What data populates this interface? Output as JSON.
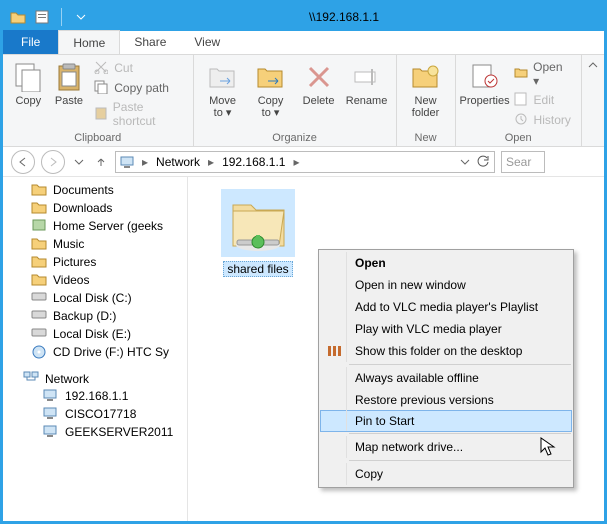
{
  "window": {
    "title": "\\\\192.168.1.1"
  },
  "tabs": {
    "file": "File",
    "home": "Home",
    "share": "Share",
    "view": "View"
  },
  "ribbon": {
    "clipboard": {
      "copy": "Copy",
      "paste": "Paste",
      "cut": "Cut",
      "copypath": "Copy path",
      "pasteshortcut": "Paste shortcut",
      "label": "Clipboard"
    },
    "organize": {
      "moveto": "Move\nto ▾",
      "copyto": "Copy\nto ▾",
      "delete": "Delete",
      "rename": "Rename",
      "label": "Organize"
    },
    "new": {
      "newfolder": "New\nfolder",
      "label": "New"
    },
    "open": {
      "properties": "Properties",
      "open": "Open ▾",
      "edit": "Edit",
      "history": "History",
      "label": "Open"
    }
  },
  "breadcrumbs": {
    "a": "Network",
    "b": "192.168.1.1"
  },
  "search_placeholder": "Sear",
  "tree": {
    "documents": "Documents",
    "downloads": "Downloads",
    "homeserver": "Home Server (geeks",
    "music": "Music",
    "pictures": "Pictures",
    "videos": "Videos",
    "localc": "Local Disk (C:)",
    "backupd": "Backup (D:)",
    "locale": "Local Disk (E:)",
    "cddrive": "CD Drive (F:) HTC Sy",
    "network": "Network",
    "pc1": "192.168.1.1",
    "pc2": "CISCO17718",
    "pc3": "GEEKSERVER2011"
  },
  "folder": {
    "name": "shared files"
  },
  "contextmenu": {
    "open": "Open",
    "opennew": "Open in new window",
    "vlcplaylist": "Add to VLC media player's Playlist",
    "vlcplay": "Play with VLC media player",
    "showdesktop": "Show this folder on the desktop",
    "alwaysoffline": "Always available offline",
    "restore": "Restore previous versions",
    "pin": "Pin to Start",
    "mapdrive": "Map network drive...",
    "copy": "Copy"
  }
}
